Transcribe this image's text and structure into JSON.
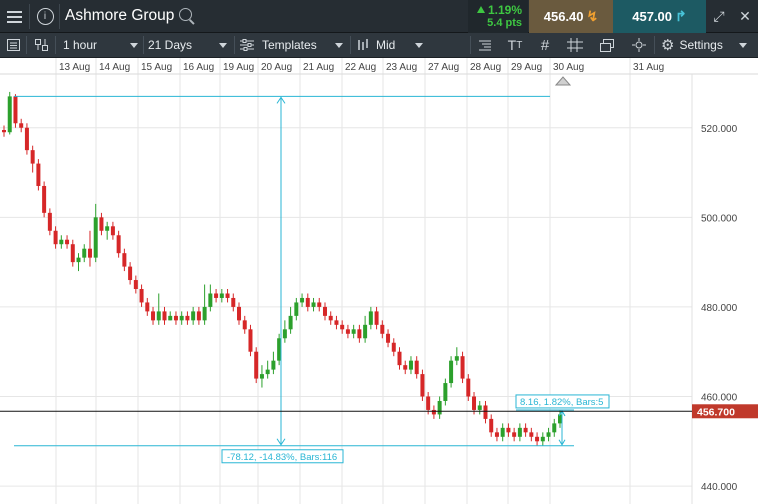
{
  "topbar": {
    "instrument_name": "Ashmore Group",
    "change_pct": "1.19%",
    "change_pts": "5.4 pts",
    "sell_price": "456.40",
    "buy_price": "457.00",
    "icons": [
      "menu-icon",
      "info-icon",
      "search-icon",
      "expand-icon",
      "close-icon"
    ]
  },
  "toolbar": {
    "interval": "1 hour",
    "range": "21 Days",
    "templates_label": "Templates",
    "price_type": "Mid",
    "settings_label": "Settings",
    "icons": [
      "layout-icon",
      "candles-icon",
      "templates-icon",
      "bars-icon",
      "indicators-icon",
      "text-icon",
      "grid-icon",
      "crosshair-icon",
      "windows-icon",
      "cursor-icon",
      "gear-icon"
    ]
  },
  "colors": {
    "up": "#2ca02c",
    "down": "#d62728",
    "measure": "#29b6d4",
    "price_badge": "#c0392b",
    "grid": "#e6e6e6"
  },
  "chart_data": {
    "type": "candlestick",
    "x_tick_labels": [
      "13 Aug",
      "14 Aug",
      "15 Aug",
      "16 Aug",
      "19 Aug",
      "20 Aug",
      "21 Aug",
      "22 Aug",
      "23 Aug",
      "27 Aug",
      "28 Aug",
      "29 Aug",
      "30 Aug",
      "31 Aug"
    ],
    "y_tick_labels": [
      "520.000",
      "500.000",
      "480.000",
      "460.000",
      "440.000"
    ],
    "y_ticks": [
      520,
      500,
      480,
      460,
      440
    ],
    "ylim": [
      436,
      532
    ],
    "current_price": "456.700",
    "current_price_value": 456.7,
    "candles": [
      [
        519.5,
        519,
        520.5,
        518
      ],
      [
        519,
        527,
        528,
        518.5
      ],
      [
        527,
        521,
        527.5,
        520
      ],
      [
        521,
        520,
        522,
        519
      ],
      [
        520,
        515,
        521,
        514
      ],
      [
        515,
        512,
        516,
        510
      ],
      [
        512,
        507,
        513,
        506
      ],
      [
        507,
        501,
        508,
        500
      ],
      [
        501,
        497,
        502,
        496
      ],
      [
        497,
        494,
        498,
        493
      ],
      [
        494,
        495,
        496,
        493
      ],
      [
        495,
        494,
        496,
        493
      ],
      [
        494,
        490,
        495,
        489
      ],
      [
        490,
        491,
        492,
        488
      ],
      [
        491,
        493,
        494,
        490
      ],
      [
        493,
        491,
        497,
        489
      ],
      [
        491,
        500,
        503,
        490
      ],
      [
        500,
        497,
        501,
        496
      ],
      [
        497,
        498,
        499,
        495
      ],
      [
        498,
        496,
        499,
        495
      ],
      [
        496,
        492,
        497,
        491
      ],
      [
        492,
        489,
        493,
        488
      ],
      [
        489,
        486,
        490,
        485
      ],
      [
        486,
        484,
        487,
        483
      ],
      [
        484,
        481,
        485,
        480
      ],
      [
        481,
        479,
        482,
        478
      ],
      [
        479,
        477,
        480,
        476
      ],
      [
        477,
        479,
        483,
        476
      ],
      [
        479,
        477,
        480,
        476
      ],
      [
        477,
        478,
        479,
        477
      ],
      [
        478,
        477,
        479,
        476
      ],
      [
        477,
        478,
        479,
        476
      ],
      [
        478,
        477,
        479,
        476
      ],
      [
        477,
        479,
        480,
        476
      ],
      [
        479,
        477,
        480,
        476
      ],
      [
        477,
        480,
        485,
        476
      ],
      [
        480,
        483,
        485,
        479
      ],
      [
        483,
        482,
        484,
        481
      ],
      [
        482,
        483,
        484,
        481
      ],
      [
        483,
        482,
        484,
        481
      ],
      [
        482,
        480,
        483,
        479
      ],
      [
        480,
        477,
        481,
        476
      ],
      [
        477,
        475,
        478,
        474
      ],
      [
        475,
        470,
        476,
        469
      ],
      [
        470,
        464,
        471,
        463
      ],
      [
        464,
        465,
        467,
        462
      ],
      [
        465,
        466,
        468,
        464
      ],
      [
        466,
        468,
        470,
        465
      ],
      [
        468,
        473,
        474,
        467
      ],
      [
        473,
        475,
        477,
        472
      ],
      [
        475,
        478,
        480,
        474
      ],
      [
        478,
        481,
        482,
        477
      ],
      [
        481,
        482,
        483,
        480
      ],
      [
        482,
        480,
        483,
        479
      ],
      [
        480,
        481,
        482,
        479
      ],
      [
        481,
        480,
        482,
        479
      ],
      [
        480,
        478,
        481,
        477
      ],
      [
        478,
        477,
        479,
        476
      ],
      [
        477,
        476,
        478,
        475
      ],
      [
        476,
        475,
        477,
        474
      ],
      [
        475,
        474,
        476,
        473
      ],
      [
        474,
        475,
        476,
        473
      ],
      [
        475,
        473,
        476,
        472
      ],
      [
        473,
        476,
        478,
        472
      ],
      [
        476,
        479,
        480,
        475
      ],
      [
        479,
        476,
        480,
        475
      ],
      [
        476,
        474,
        477,
        473
      ],
      [
        474,
        472,
        475,
        471
      ],
      [
        472,
        470,
        473,
        469
      ],
      [
        470,
        467,
        471,
        466
      ],
      [
        467,
        466,
        468,
        465
      ],
      [
        466,
        468,
        469,
        465
      ],
      [
        468,
        465,
        469,
        464
      ],
      [
        465,
        460,
        466,
        459
      ],
      [
        460,
        457,
        461,
        456
      ],
      [
        457,
        456,
        458,
        455
      ],
      [
        456,
        459,
        460,
        455
      ],
      [
        459,
        463,
        464,
        458
      ],
      [
        463,
        468,
        469,
        462
      ],
      [
        468,
        469,
        471,
        467
      ],
      [
        469,
        464,
        470,
        463
      ],
      [
        464,
        460,
        465,
        459
      ],
      [
        460,
        457,
        461,
        456
      ],
      [
        457,
        458,
        459,
        456
      ],
      [
        458,
        455,
        459,
        454
      ],
      [
        455,
        452,
        456,
        451
      ],
      [
        452,
        451,
        453,
        450
      ],
      [
        451,
        453,
        454,
        450
      ],
      [
        453,
        452,
        454,
        451
      ],
      [
        452,
        451,
        453,
        450
      ],
      [
        451,
        453,
        454,
        450
      ],
      [
        453,
        452,
        454,
        451
      ],
      [
        452,
        451,
        453,
        450
      ],
      [
        451,
        450,
        452,
        449
      ],
      [
        450,
        451,
        452,
        449
      ],
      [
        451,
        452,
        453,
        450
      ],
      [
        452,
        454,
        455,
        451
      ],
      [
        454,
        456,
        457,
        453
      ]
    ],
    "measurements": [
      {
        "label": "-78.12, -14.83%, Bars:116",
        "from": 527,
        "to": 449
      },
      {
        "label": "8.16, 1.82%, Bars:5",
        "from": 449,
        "to": 457
      }
    ]
  }
}
